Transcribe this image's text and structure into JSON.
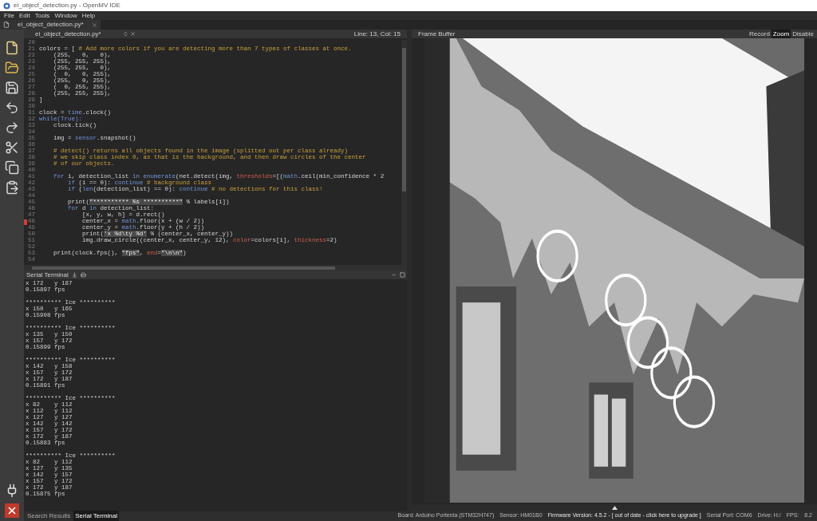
{
  "window": {
    "title": "ei_object_detection.py - OpenMV IDE"
  },
  "menu": [
    "File",
    "Edit",
    "Tools",
    "Window",
    "Help"
  ],
  "file_tab": {
    "label": "ei_object_detection.py*"
  },
  "editor": {
    "filename": "ei_object_detection.py*",
    "cursor": "Line: 13, Col: 15",
    "lines": [
      {
        "number": "20",
        "breakpoint": false
      },
      {
        "number": "21",
        "breakpoint": false,
        "segments": [
          {
            "kind": "plain",
            "text": "colors = [ "
          },
          {
            "kind": "comment",
            "text": "# Add more colors if you are detecting more than 7 types of classes at once."
          }
        ]
      },
      {
        "number": "22",
        "breakpoint": false,
        "segments": [
          {
            "kind": "plain",
            "text": "    (255,   0,   0),"
          }
        ]
      },
      {
        "number": "23",
        "breakpoint": false,
        "segments": [
          {
            "kind": "plain",
            "text": "    (255, 255, 255),"
          }
        ]
      },
      {
        "number": "24",
        "breakpoint": false,
        "segments": [
          {
            "kind": "plain",
            "text": "    (255, 255,   0),"
          }
        ]
      },
      {
        "number": "25",
        "breakpoint": false,
        "segments": [
          {
            "kind": "plain",
            "text": "    (  0,   0, 255),"
          }
        ]
      },
      {
        "number": "26",
        "breakpoint": false,
        "segments": [
          {
            "kind": "plain",
            "text": "    (255,   0, 255),"
          }
        ]
      },
      {
        "number": "27",
        "breakpoint": false,
        "segments": [
          {
            "kind": "plain",
            "text": "    (  0, 255, 255),"
          }
        ]
      },
      {
        "number": "28",
        "breakpoint": false,
        "segments": [
          {
            "kind": "plain",
            "text": "    (255, 255, 255),"
          }
        ]
      },
      {
        "number": "29",
        "breakpoint": false,
        "segments": [
          {
            "kind": "plain",
            "text": "]"
          }
        ]
      },
      {
        "number": "30",
        "breakpoint": false
      },
      {
        "number": "31",
        "breakpoint": false,
        "segments": [
          {
            "kind": "plain",
            "text": "clock = "
          },
          {
            "kind": "keyword",
            "text": "time"
          },
          {
            "kind": "plain",
            "text": ".clock()"
          }
        ]
      },
      {
        "number": "32",
        "breakpoint": false,
        "segments": [
          {
            "kind": "keyword",
            "text": "while(True):"
          }
        ]
      },
      {
        "number": "33",
        "breakpoint": false,
        "segments": [
          {
            "kind": "plain",
            "text": "    clock.tick()"
          }
        ]
      },
      {
        "number": "34",
        "breakpoint": false
      },
      {
        "number": "35",
        "breakpoint": false,
        "segments": [
          {
            "kind": "plain",
            "text": "    img = "
          },
          {
            "kind": "keyword",
            "text": "sensor"
          },
          {
            "kind": "plain",
            "text": ".snapshot()"
          }
        ]
      },
      {
        "number": "36",
        "breakpoint": false
      },
      {
        "number": "37",
        "breakpoint": false,
        "segments": [
          {
            "kind": "comment",
            "text": "    # detect() returns all objects found in the image (splitted out per class already)"
          }
        ]
      },
      {
        "number": "38",
        "breakpoint": false,
        "segments": [
          {
            "kind": "comment",
            "text": "    # we skip class index 0, as that is the background, and then draw circles of the center"
          }
        ]
      },
      {
        "number": "39",
        "breakpoint": false,
        "segments": [
          {
            "kind": "comment",
            "text": "    # of our objects."
          }
        ]
      },
      {
        "number": "40",
        "breakpoint": false
      },
      {
        "number": "41",
        "breakpoint": false,
        "segments": [
          {
            "kind": "keyword",
            "text": "    for"
          },
          {
            "kind": "plain",
            "text": " i, detection_list "
          },
          {
            "kind": "keyword",
            "text": "in enumerate"
          },
          {
            "kind": "plain",
            "text": "(net.detect(img, "
          },
          {
            "kind": "param",
            "text": "thresholds"
          },
          {
            "kind": "plain",
            "text": "=[("
          },
          {
            "kind": "keyword",
            "text": "math"
          },
          {
            "kind": "plain",
            "text": ".ceil(min_confidence * 2"
          }
        ]
      },
      {
        "number": "42",
        "breakpoint": false,
        "segments": [
          {
            "kind": "keyword",
            "text": "        if"
          },
          {
            "kind": "plain",
            "text": " (i == 0): "
          },
          {
            "kind": "keyword",
            "text": "continue"
          },
          {
            "kind": "comment",
            "text": " # background class"
          }
        ]
      },
      {
        "number": "43",
        "breakpoint": false,
        "segments": [
          {
            "kind": "keyword",
            "text": "        if"
          },
          {
            "kind": "plain",
            "text": " ("
          },
          {
            "kind": "keyword",
            "text": "len"
          },
          {
            "kind": "plain",
            "text": "(detection_list) == 0): "
          },
          {
            "kind": "keyword",
            "text": "continue"
          },
          {
            "kind": "comment",
            "text": " # no detections for this class!"
          }
        ]
      },
      {
        "number": "44",
        "breakpoint": false
      },
      {
        "number": "45",
        "breakpoint": false,
        "segments": [
          {
            "kind": "plain",
            "text": "        print("
          },
          {
            "kind": "string",
            "text": "\"********** %s **********\""
          },
          {
            "kind": "plain",
            "text": " % labels[i])"
          }
        ]
      },
      {
        "number": "46",
        "breakpoint": false,
        "segments": [
          {
            "kind": "keyword",
            "text": "        for"
          },
          {
            "kind": "plain",
            "text": " d "
          },
          {
            "kind": "keyword",
            "text": "in"
          },
          {
            "kind": "plain",
            "text": " detection_list:"
          }
        ]
      },
      {
        "number": "47",
        "breakpoint": false,
        "segments": [
          {
            "kind": "plain",
            "text": "            [x, y, w, h] = d.rect()"
          }
        ]
      },
      {
        "number": "48",
        "breakpoint": true,
        "segments": [
          {
            "kind": "plain",
            "text": "            center_x = "
          },
          {
            "kind": "keyword",
            "text": "math"
          },
          {
            "kind": "plain",
            "text": ".floor(x + (w / 2))"
          }
        ]
      },
      {
        "number": "49",
        "breakpoint": false,
        "segments": [
          {
            "kind": "plain",
            "text": "            center_y = "
          },
          {
            "kind": "keyword",
            "text": "math"
          },
          {
            "kind": "plain",
            "text": ".floor(y + (h / 2))"
          }
        ]
      },
      {
        "number": "50",
        "breakpoint": false,
        "segments": [
          {
            "kind": "plain",
            "text": "            print("
          },
          {
            "kind": "string",
            "text": "'x %d\\ty %d'"
          },
          {
            "kind": "plain",
            "text": " % (center_x, center_y))"
          }
        ]
      },
      {
        "number": "51",
        "breakpoint": false,
        "segments": [
          {
            "kind": "plain",
            "text": "            img.draw_circle((center_x, center_y, 12), "
          },
          {
            "kind": "param",
            "text": "color"
          },
          {
            "kind": "plain",
            "text": "=colors[i], "
          },
          {
            "kind": "param",
            "text": "thickness"
          },
          {
            "kind": "plain",
            "text": "=2)"
          }
        ]
      },
      {
        "number": "52",
        "breakpoint": false
      },
      {
        "number": "53",
        "breakpoint": false,
        "segments": [
          {
            "kind": "plain",
            "text": "    print(clock.fps(), "
          },
          {
            "kind": "string",
            "text": "\"fps\""
          },
          {
            "kind": "plain",
            "text": ", "
          },
          {
            "kind": "param",
            "text": "end"
          },
          {
            "kind": "plain",
            "text": "="
          },
          {
            "kind": "string",
            "text": "\"\\n\\n\""
          },
          {
            "kind": "plain",
            "text": ")"
          }
        ]
      },
      {
        "number": "54",
        "breakpoint": false
      }
    ]
  },
  "terminal": {
    "title": "Serial Terminal",
    "blocks": [
      {
        "lines": [
          "x 172   y 187",
          "0.15897 fps"
        ]
      },
      {
        "lines": [
          "********** Ice **********",
          "x 150   y 165",
          "0.15908 fps"
        ]
      },
      {
        "lines": [
          "********** Ice **********",
          "x 135   y 150",
          "x 157   y 172",
          "0.15899 fps"
        ]
      },
      {
        "lines": [
          "********** Ice **********",
          "x 142   y 158",
          "x 157   y 172",
          "x 172   y 187",
          "0.15891 fps"
        ]
      },
      {
        "lines": [
          "********** Ice **********",
          "x 82    y 112",
          "x 112   y 112",
          "x 127   y 127",
          "x 142   y 142",
          "x 157   y 172",
          "x 172   y 187",
          "0.15883 fps"
        ]
      },
      {
        "lines": [
          "********** Ice **********",
          "x 82    y 112",
          "x 127   y 135",
          "x 142   y 157",
          "x 157   y 172",
          "x 172   y 187",
          "0.15875 fps"
        ]
      }
    ]
  },
  "bottom_tabs": [
    {
      "label": "Search Results",
      "selected": false
    },
    {
      "label": "Serial Terminal",
      "selected": true
    }
  ],
  "frame_buffer": {
    "title": "Frame Buffer",
    "buttons": [
      {
        "label": "Record",
        "selected": false
      },
      {
        "label": "Zoom",
        "selected": true
      },
      {
        "label": "Disable",
        "selected": false
      }
    ]
  },
  "status_bar": [
    {
      "kind": "text",
      "text": "Board: Arduino Portenta (STM32H747)"
    },
    {
      "kind": "text",
      "text": "Sensor: HM01B0"
    },
    {
      "kind": "link",
      "text": "Firmware Version: 4.5.2 - [ out of date - click here to upgrade ]"
    },
    {
      "kind": "text",
      "text": "Serial Port: COM6"
    },
    {
      "kind": "text",
      "text": "Drive: H:/"
    },
    {
      "kind": "text",
      "text": "FPS:"
    },
    {
      "kind": "text",
      "text": "8.2"
    }
  ]
}
